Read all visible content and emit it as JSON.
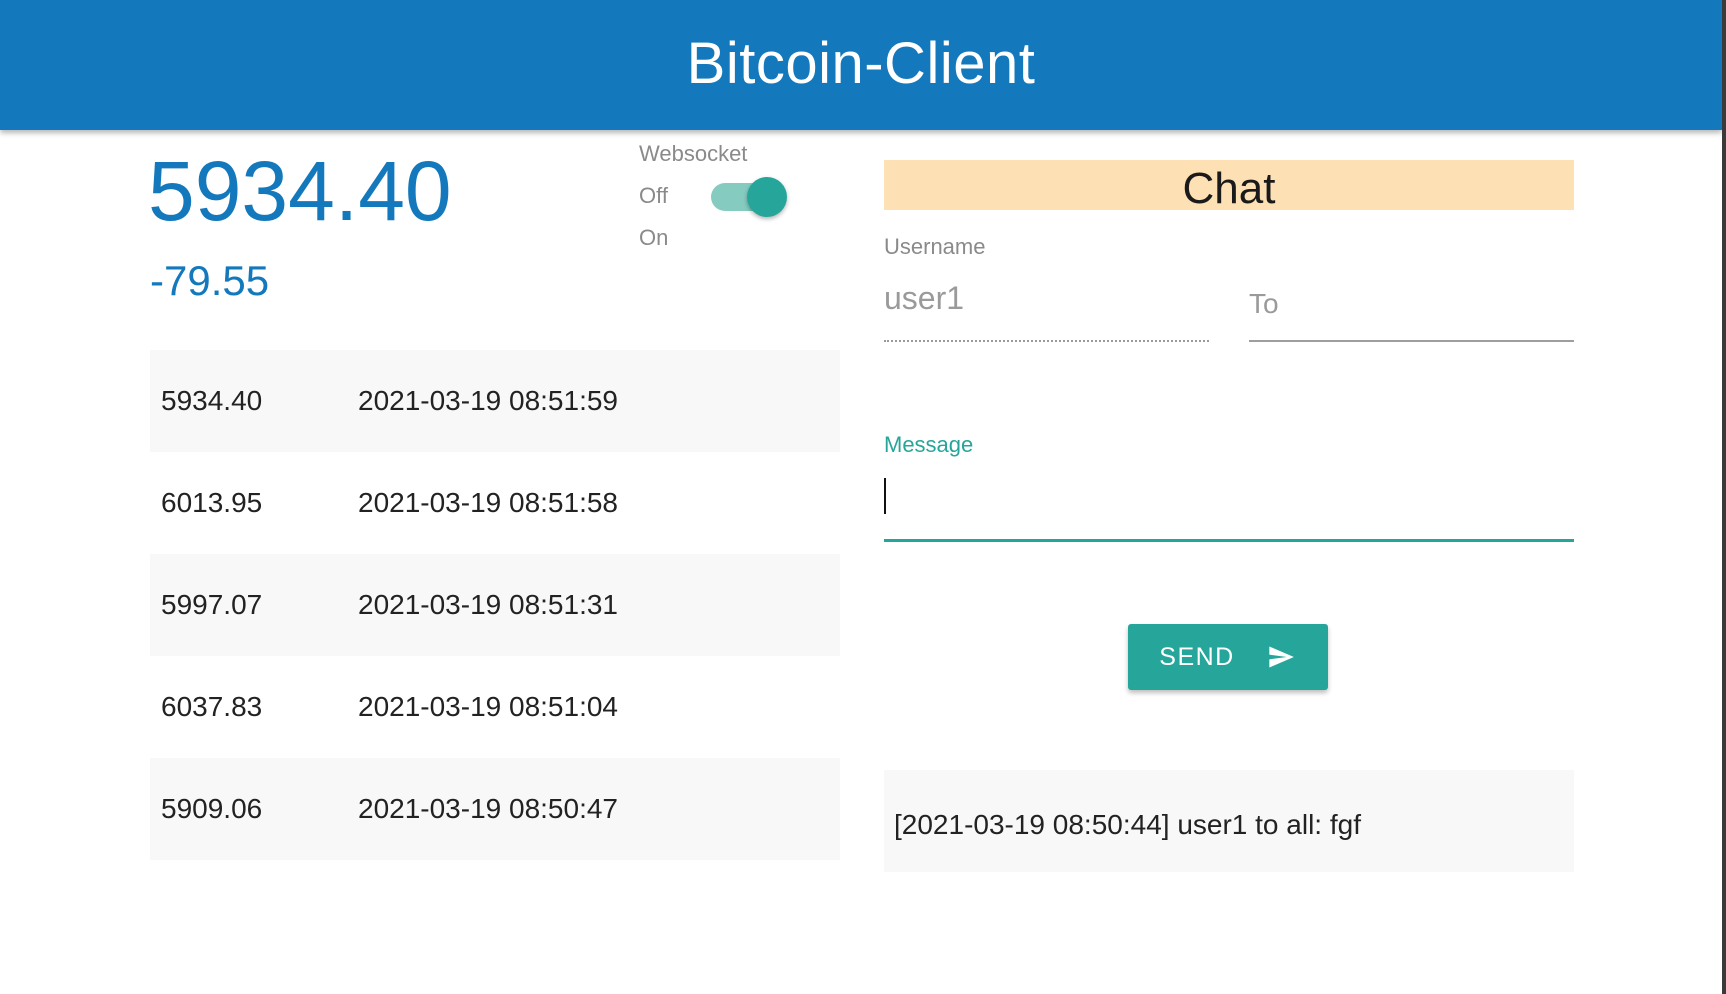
{
  "header": {
    "title": "Bitcoin-Client"
  },
  "ticker": {
    "current_price": "5934.40",
    "change": "-79.55"
  },
  "websocket": {
    "label": "Websocket",
    "off_label": "Off",
    "on_label": "On",
    "enabled": true
  },
  "history": [
    {
      "price": "5934.40",
      "time": "2021-03-19 08:51:59"
    },
    {
      "price": "6013.95",
      "time": "2021-03-19 08:51:58"
    },
    {
      "price": "5997.07",
      "time": "2021-03-19 08:51:31"
    },
    {
      "price": "6037.83",
      "time": "2021-03-19 08:51:04"
    },
    {
      "price": "5909.06",
      "time": "2021-03-19 08:50:47"
    }
  ],
  "chat": {
    "title": "Chat",
    "username_label": "Username",
    "username_value": "user1",
    "to_placeholder": "To",
    "to_value": "",
    "message_label": "Message",
    "message_value": "",
    "send_label": "SEND",
    "messages": [
      "[2021-03-19 08:50:44] user1 to all: fgf"
    ]
  },
  "colors": {
    "primary": "#1479bc",
    "accent": "#26a69a",
    "chat_header_bg": "#fde0b3"
  },
  "icons": {
    "send": "send-icon"
  }
}
